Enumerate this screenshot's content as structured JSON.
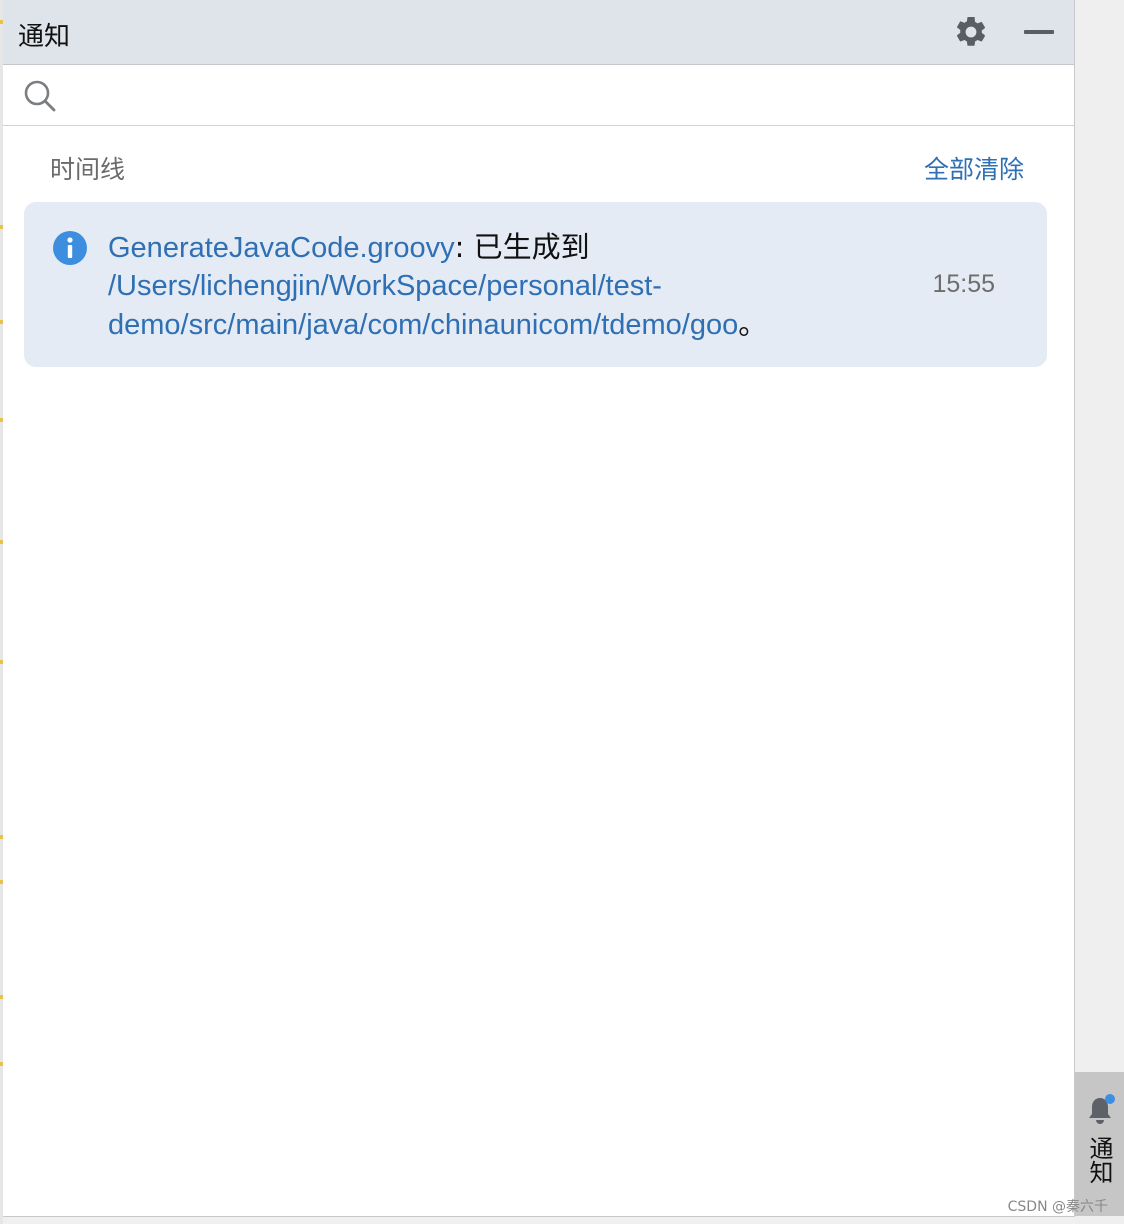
{
  "panel": {
    "title": "通知",
    "settings_icon": "gear-icon",
    "minimize_icon": "minimize-icon"
  },
  "search": {
    "icon": "search-icon",
    "value": "",
    "placeholder": ""
  },
  "timeline": {
    "title": "时间线",
    "clear_all_label": "全部清除"
  },
  "notifications": [
    {
      "icon": "info-icon",
      "source_link": "GenerateJavaCode.groovy",
      "text_after_link": ": 已生成到",
      "path_link_line1": "/Users/lichengjin/WorkSpace/personal/test-",
      "path_link_line2": "demo/src/main/java/com/chinaunicom/tdemo/goo",
      "trailing_punct": "。",
      "time": "15:55"
    }
  ],
  "side_tab": {
    "icon": "bell-icon",
    "label": "通知",
    "badge_color": "#3d8ede"
  },
  "watermark": "CSDN @秦六千",
  "colors": {
    "accent": "#2f6fb4",
    "card_bg": "#e4ebf4",
    "titlebar_bg": "#dfe3ea"
  }
}
